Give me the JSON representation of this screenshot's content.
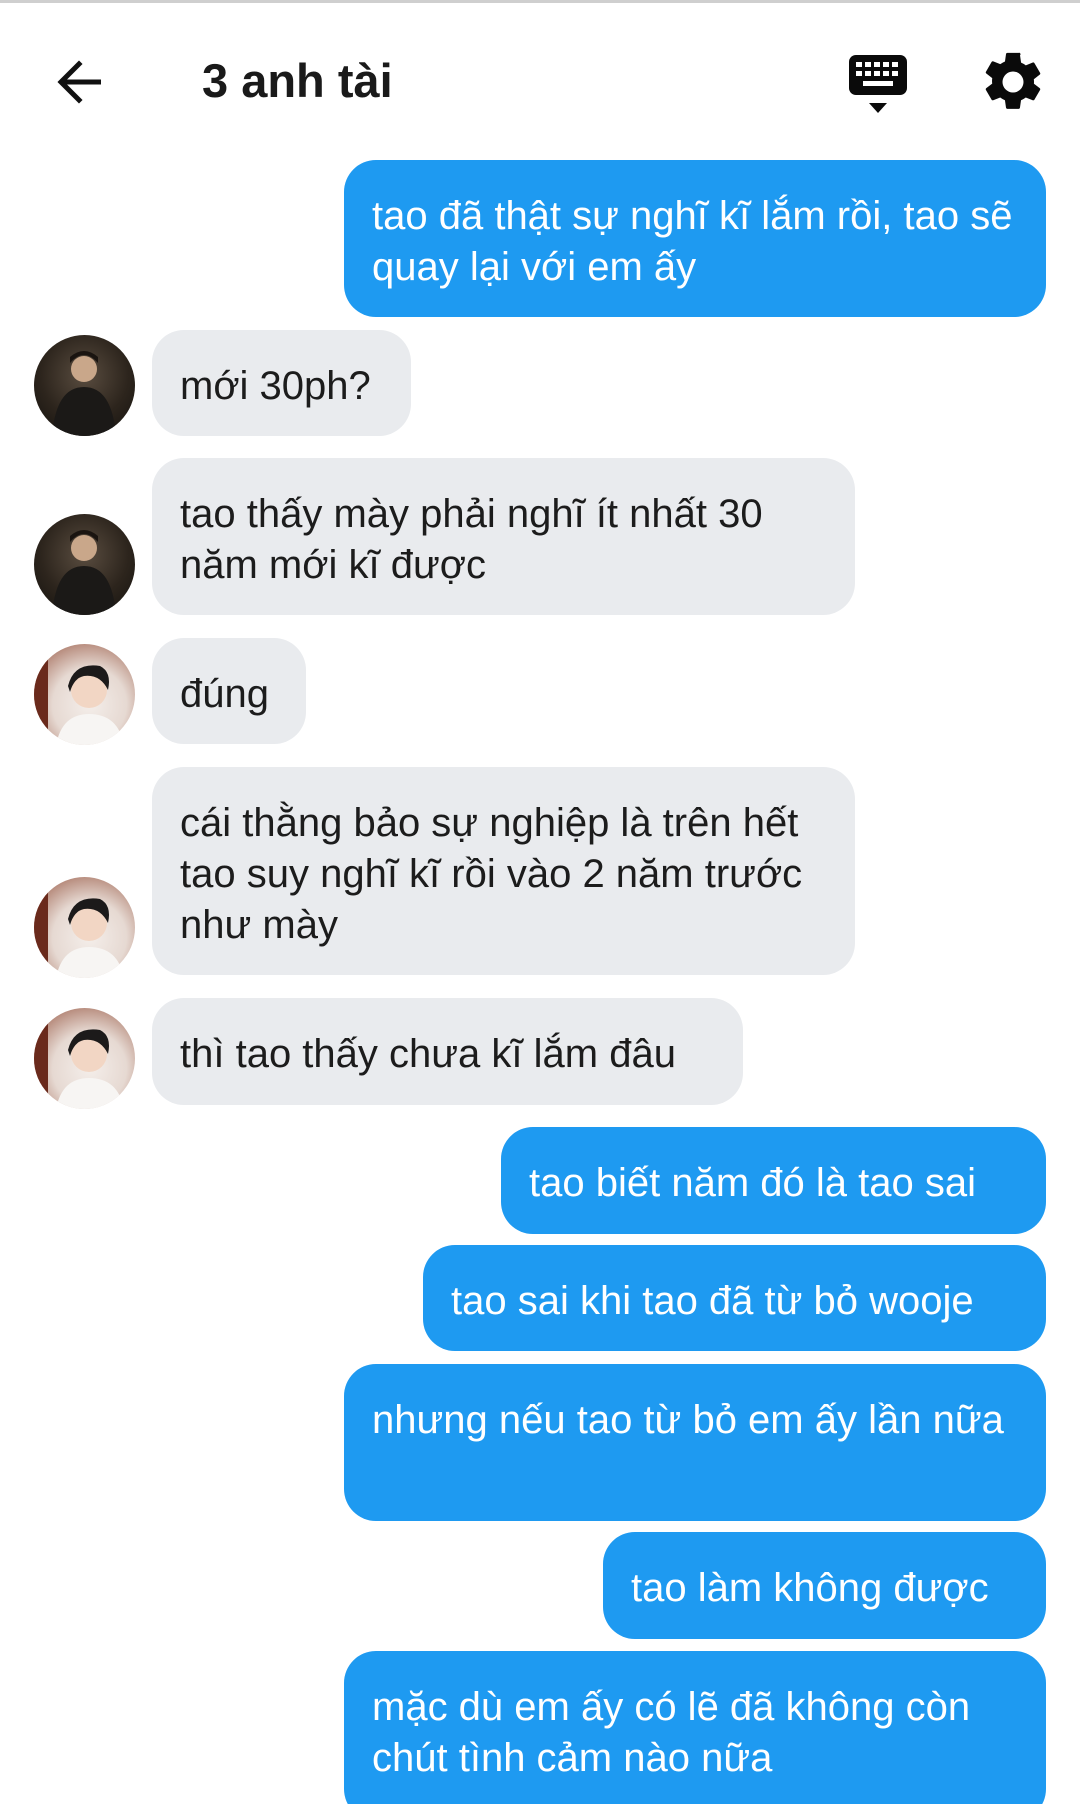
{
  "header": {
    "title": "3 anh tài",
    "back_icon": "arrow-left-icon",
    "keyboard_icon": "keyboard-icon",
    "settings_icon": "gear-icon"
  },
  "colors": {
    "outgoing_bubble": "#1e9af1",
    "incoming_bubble": "#e9ebee",
    "outgoing_text": "#ffffff",
    "incoming_text": "#1c1c1c"
  },
  "messages": [
    {
      "direction": "out",
      "text": "tao đã thật sự nghĩ kĩ lắm rồi, tao sẽ quay lại với em ấy"
    },
    {
      "direction": "in",
      "sender_avatar": "avatar-dark",
      "text": "mới 30ph?"
    },
    {
      "direction": "in",
      "sender_avatar": "avatar-dark",
      "text": "tao thấy mày phải nghĩ ít nhất 30 năm mới kĩ được"
    },
    {
      "direction": "in",
      "sender_avatar": "avatar-light",
      "text": "đúng"
    },
    {
      "direction": "in",
      "sender_avatar": "avatar-light",
      "text": "cái thằng bảo sự nghiệp là trên hết tao suy nghĩ kĩ rồi vào 2 năm trước như mày"
    },
    {
      "direction": "in",
      "sender_avatar": "avatar-light",
      "text": "thì tao thấy chưa kĩ lắm đâu"
    },
    {
      "direction": "out",
      "text": "tao biết năm đó là tao sai"
    },
    {
      "direction": "out",
      "text": "tao sai khi tao đã từ bỏ wooje"
    },
    {
      "direction": "out",
      "text": "nhưng nếu tao từ bỏ em ấy lần nữa"
    },
    {
      "direction": "out",
      "text": "tao làm không được"
    },
    {
      "direction": "out",
      "text": "mặc dù em ấy có lẽ đã không còn chút tình cảm nào nữa"
    }
  ]
}
